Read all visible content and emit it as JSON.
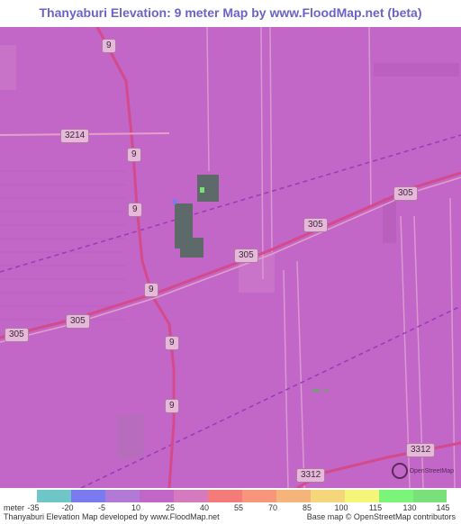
{
  "title": "Thanyaburi Elevation: 9 meter Map by www.FloodMap.net (beta)",
  "map": {
    "base_color": "#c266c8",
    "road_shields": [
      "9",
      "3214",
      "9",
      "9",
      "305",
      "305",
      "9",
      "305",
      "305",
      "9",
      "9",
      "3312",
      "3312"
    ],
    "osm_logo_text": "OpenStreetMap"
  },
  "legend": {
    "unit_label": "meter",
    "colors": [
      "#6fc6c6",
      "#7b7bf0",
      "#b27ad6",
      "#c266c8",
      "#d67ac0",
      "#f57a7a",
      "#f7967a",
      "#f5b47a",
      "#f5d67a",
      "#f5f57a",
      "#7af57a",
      "#7ae07a"
    ],
    "ticks": [
      "-35",
      "-20",
      "-5",
      "10",
      "25",
      "40",
      "55",
      "70",
      "85",
      "100",
      "115",
      "130",
      "145"
    ]
  },
  "footer": {
    "left": "Thanyaburi Elevation Map developed by www.FloodMap.net",
    "right": "Base map © OpenStreetMap contributors"
  }
}
